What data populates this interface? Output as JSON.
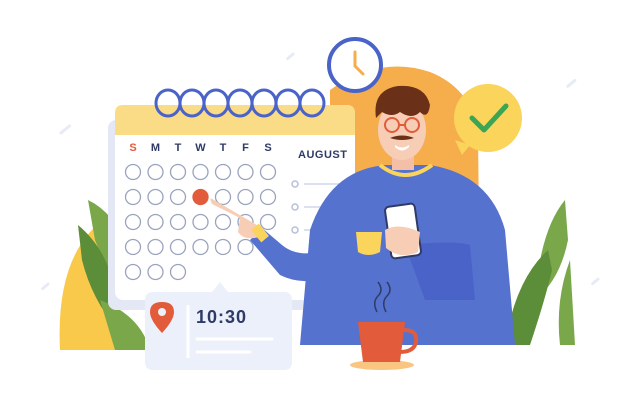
{
  "calendar": {
    "days": [
      "S",
      "M",
      "T",
      "W",
      "T",
      "F",
      "S"
    ],
    "month": "AUGUST",
    "selected_day_index": 10,
    "day_rows": 5
  },
  "time_card": {
    "time": "10:30"
  },
  "icons": {
    "clock": "clock-icon",
    "check": "checkmark-badge-icon",
    "pin": "location-pin-icon",
    "mug": "coffee-mug-icon",
    "phone": "smartphone-icon"
  },
  "colors": {
    "calendar_header": "#fbdc86",
    "accent_red": "#e25c3b",
    "ring_blue": "#4a63c9",
    "shirt_blue": "#5672cf",
    "sun_orange": "#f6ad4c",
    "check_yellow": "#fbd45b",
    "check_green": "#3aa655",
    "leaf_green": "#7aa74a",
    "hair_brown": "#6b3118",
    "text_dark": "#2f3b66"
  }
}
